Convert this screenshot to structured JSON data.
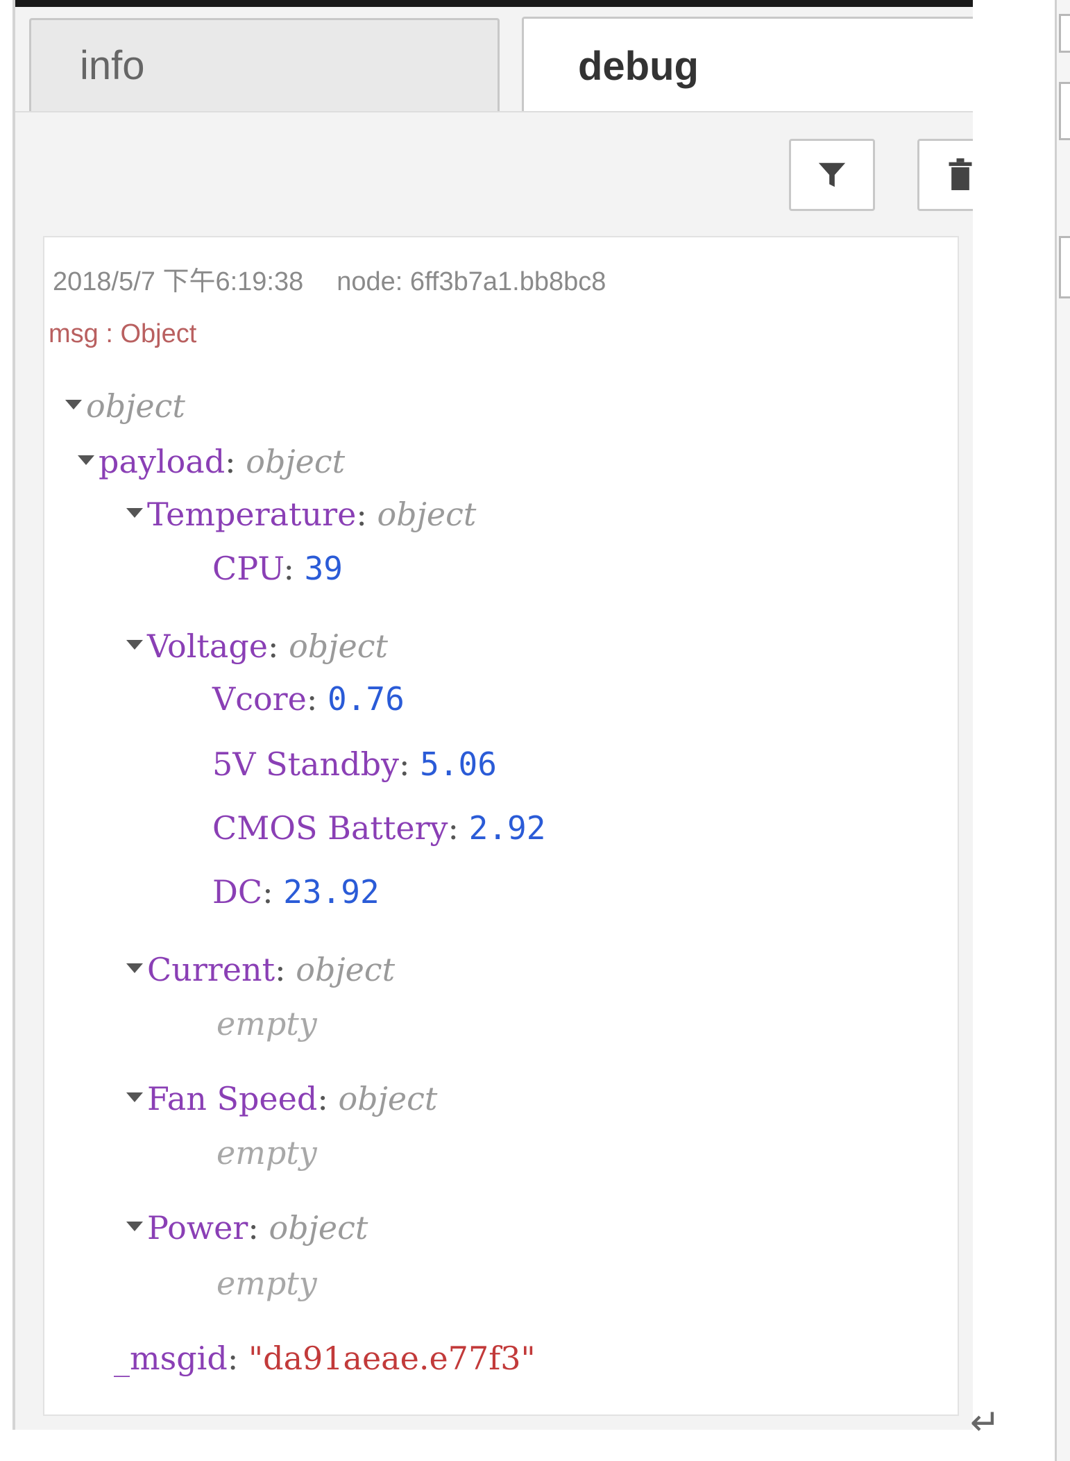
{
  "tabs": [
    {
      "label": "info",
      "active": false
    },
    {
      "label": "debug",
      "active": true
    }
  ],
  "toolbar": {
    "filter_icon": "filter-icon",
    "clear_icon": "trash-icon"
  },
  "message": {
    "timestamp": "2018/5/7 下午6:19:38",
    "node": "node: 6ff3b7a1.bb8bc8",
    "msg_label": "msg : Object"
  },
  "tree": {
    "root_type": "object",
    "payload": {
      "key": "payload",
      "type": "object"
    },
    "temperature": {
      "key": "Temperature",
      "type": "object"
    },
    "cpu": {
      "key": "CPU",
      "value": "39"
    },
    "voltage": {
      "key": "Voltage",
      "type": "object"
    },
    "vcore": {
      "key": "Vcore",
      "value": "0.76"
    },
    "standby": {
      "key": "5V Standby",
      "value": "5.06"
    },
    "cmos": {
      "key": "CMOS Battery",
      "value": "2.92"
    },
    "dc": {
      "key": "DC",
      "value": "23.92"
    },
    "current": {
      "key": "Current",
      "type": "object",
      "empty": "empty"
    },
    "fan_speed": {
      "key": "Fan Speed",
      "type": "object",
      "empty": "empty"
    },
    "power": {
      "key": "Power",
      "type": "object",
      "empty": "empty"
    },
    "msgid": {
      "key": "_msgid",
      "value": "\"da91aeae.e77f3\""
    }
  },
  "colors": {
    "key": "#8a3fb5",
    "number": "#2a5bd7",
    "string": "#c23a3a",
    "type": "#9a9a9a",
    "msg_label": "#b96060"
  }
}
